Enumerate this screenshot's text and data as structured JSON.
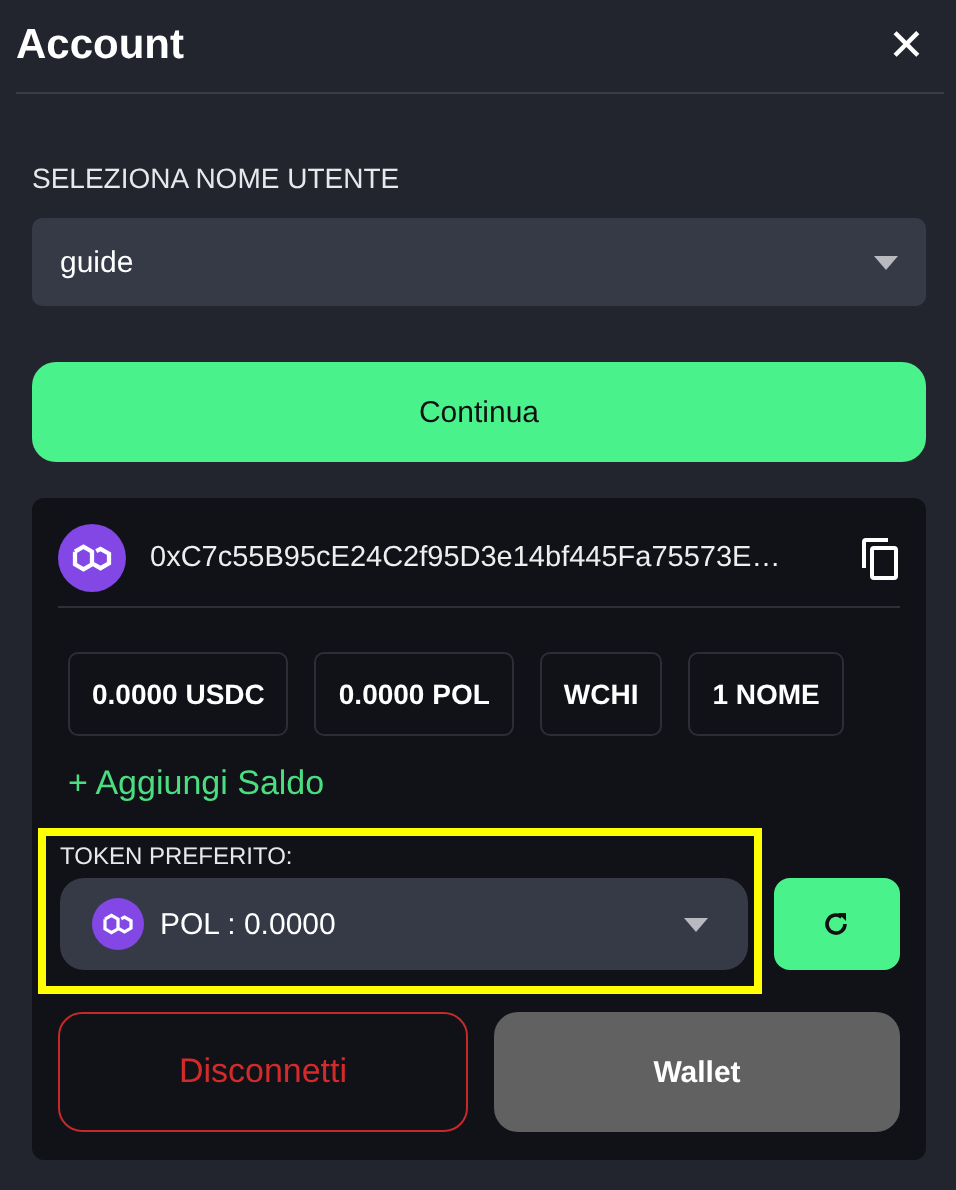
{
  "header": {
    "title": "Account",
    "close": "✕"
  },
  "username": {
    "label": "SELEZIONA NOME UTENTE",
    "value": "guide"
  },
  "continue_button": "Continua",
  "wallet_card": {
    "address": "0xC7c55B95cE24C2f95D3e14bf445Fa75573E…",
    "balances": [
      "0.0000 USDC",
      "0.0000 POL",
      "WCHI",
      "1 NOME"
    ],
    "add_funds": "+ Aggiungi Saldo",
    "preferred_token": {
      "label": "TOKEN PREFERITO:",
      "value": "POL : 0.0000",
      "highlighted": true
    },
    "buttons": [
      {
        "label": "Disconnetti",
        "kind": "danger"
      },
      {
        "label": "Wallet",
        "kind": "neutral"
      }
    ]
  }
}
